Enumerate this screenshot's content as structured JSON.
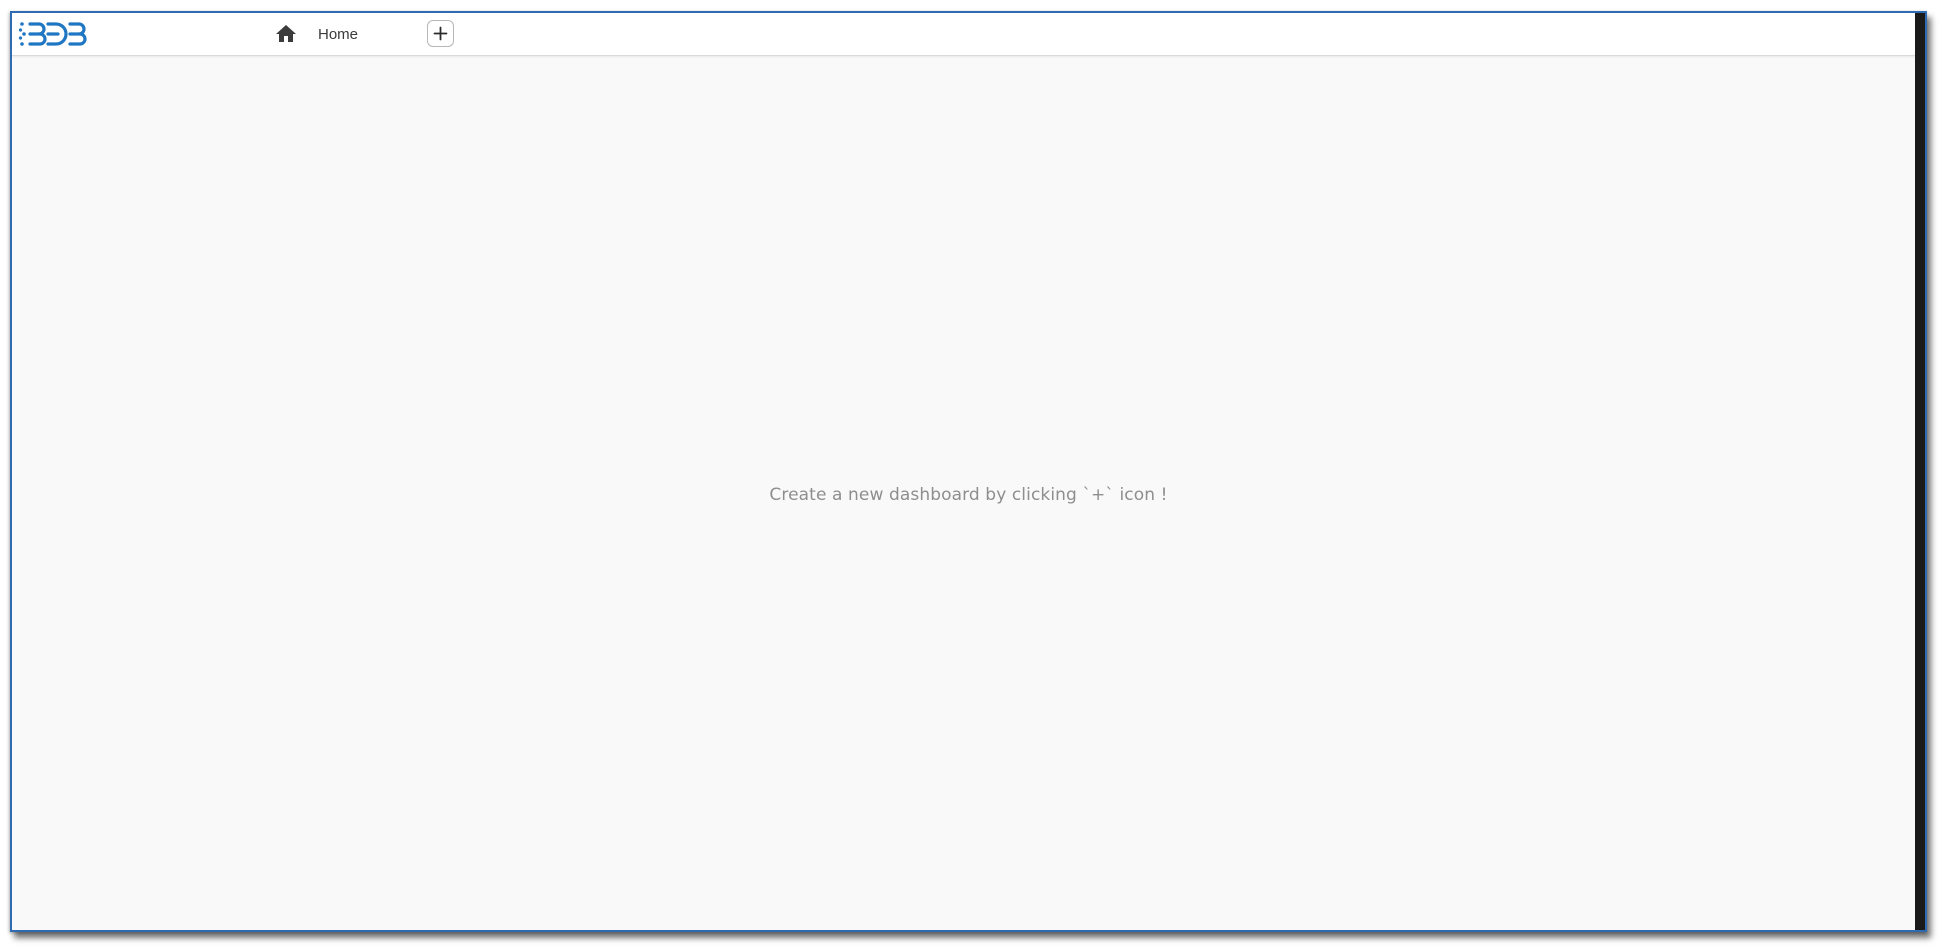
{
  "app": {
    "logo_icon": "bdb-logo",
    "brand_color": "#1f77c4"
  },
  "header": {
    "home_icon": "home-icon",
    "home_label": "Home",
    "add_icon": "plus-icon"
  },
  "main": {
    "empty_message": "Create a new dashboard by clicking `+` icon !"
  }
}
